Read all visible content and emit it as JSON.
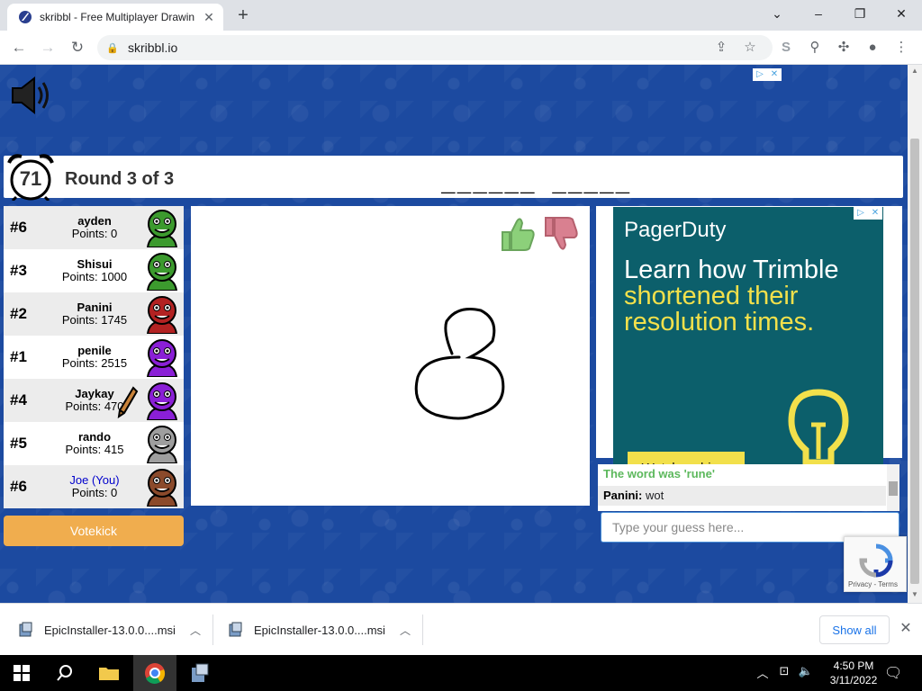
{
  "browser": {
    "tab_title": "skribbl - Free Multiplayer Drawin",
    "url": "skribbl.io"
  },
  "game": {
    "timer": "71",
    "round": "Round 3 of 3",
    "word_hint": "______ _____"
  },
  "players": [
    {
      "rank": "#6",
      "name": "ayden",
      "points": "Points: 0",
      "color": "#3c9a2e",
      "you": false,
      "drawing": false
    },
    {
      "rank": "#3",
      "name": "Shisui",
      "points": "Points: 1000",
      "color": "#3c9a2e",
      "you": false,
      "drawing": false
    },
    {
      "rank": "#2",
      "name": "Panini",
      "points": "Points: 1745",
      "color": "#b22222",
      "you": false,
      "drawing": false
    },
    {
      "rank": "#1",
      "name": "penile",
      "points": "Points: 2515",
      "color": "#8a1fd6",
      "you": false,
      "drawing": false
    },
    {
      "rank": "#4",
      "name": "Jaykay",
      "points": "Points: 470",
      "color": "#8a1fd6",
      "you": false,
      "drawing": true
    },
    {
      "rank": "#5",
      "name": "rando",
      "points": "Points: 415",
      "color": "#9e9e9e",
      "you": false,
      "drawing": false
    },
    {
      "rank": "#6",
      "name": "Joe (You)",
      "points": "Points: 0",
      "color": "#8b4a2b",
      "you": true,
      "drawing": false
    }
  ],
  "votekick_label": "Votekick",
  "ad": {
    "brand": "PagerDuty",
    "headline_1": "Learn how Trimble",
    "headline_2": "shortened their resolution times.",
    "cta": "Watch webinar"
  },
  "chat": {
    "system_message": "The word was 'rune'",
    "author": "Panini:",
    "message": "wot",
    "placeholder": "Type your guess here..."
  },
  "recaptcha_label": "Privacy - Terms",
  "downloads": {
    "items": [
      "EpicInstaller-13.0.0....msi",
      "EpicInstaller-13.0.0....msi"
    ],
    "show_all": "Show all"
  },
  "taskbar": {
    "time": "4:50 PM",
    "date": "3/11/2022"
  },
  "colors": {
    "page_bg": "#1c4aa0",
    "votekick": "#f0ad4e",
    "ad_bg": "#0c5f6b",
    "ad_accent": "#f2e04b",
    "chat_system": "#5cb85c"
  }
}
